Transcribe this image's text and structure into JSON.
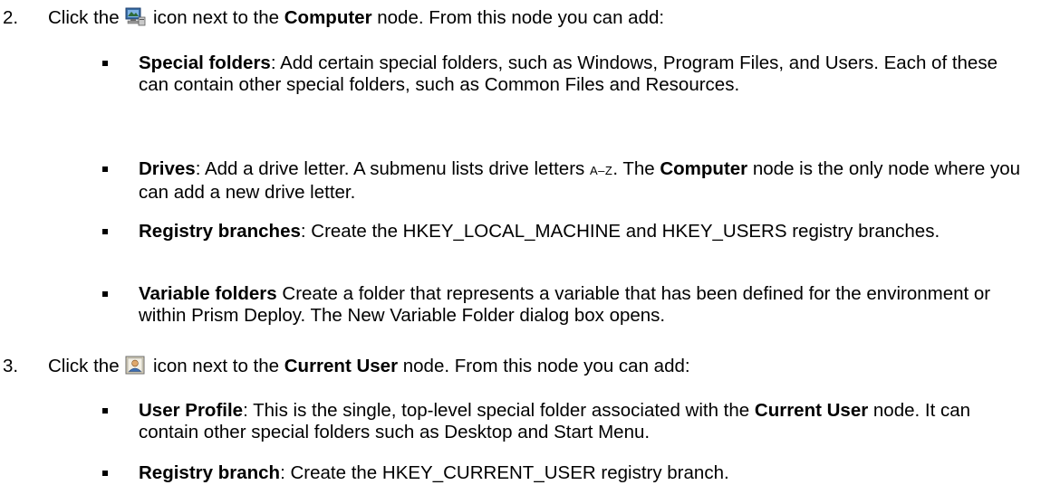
{
  "step2": {
    "number": "2.",
    "pre": "Click the ",
    "icon": "computer-node-icon",
    "mid": " icon next to the ",
    "node": "Computer",
    "post": " node. From this node you can add:"
  },
  "step2_bullets": [
    {
      "term": "Special folders",
      "text": ": Add certain special folders, such as Windows, Program Files, and Users. Each of these can contain other special folders, such as Common Files and Resources."
    },
    {
      "term": "Drives",
      "text_a": ": Add a drive letter. A submenu lists drive letters ",
      "range": "A–Z",
      "text_b": ". The ",
      "node": "Computer",
      "text_c": " node is the only node where you can add a new drive letter."
    },
    {
      "term": "Registry branches",
      "text": ": Create the HKEY_LOCAL_MACHINE and HKEY_USERS registry branches."
    },
    {
      "term": "Variable folders",
      "text": " Create a folder that represents a variable that has been defined for the environment or within Prism Deploy. The New Variable Folder dialog box opens."
    }
  ],
  "step3": {
    "number": "3.",
    "pre": "Click the ",
    "icon": "current-user-node-icon",
    "mid": " icon next to the ",
    "node": "Current User",
    "post": " node. From this node you can add:"
  },
  "step3_bullets": [
    {
      "term": "User Profile",
      "text_a": ": This is the single, top-level special folder associated with the ",
      "node": "Current User",
      "text_b": " node. It can contain other special folders such as Desktop and Start Menu."
    },
    {
      "term": "Registry branch",
      "text": ": Create the HKEY_CURRENT_USER registry branch."
    }
  ]
}
